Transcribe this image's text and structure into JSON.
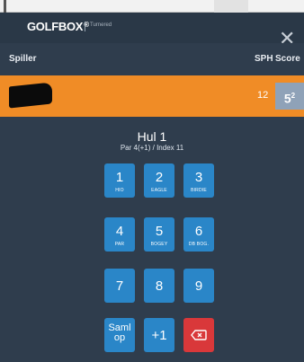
{
  "header": {
    "logo": "GOLFBOX",
    "logo_reg": "®",
    "logo_sub": "Turnered",
    "close_label": "✕"
  },
  "columns": {
    "player": "Spiller",
    "sph": "SPH",
    "score": "Score"
  },
  "player_row": {
    "sph": "12",
    "score": "5",
    "score_sup": "2"
  },
  "hole": {
    "title": "Hul 1",
    "subtitle": "Par 4(+1) / Index 11"
  },
  "keypad": {
    "k1": {
      "num": "1",
      "label": "HIO"
    },
    "k2": {
      "num": "2",
      "label": "EAGLE"
    },
    "k3": {
      "num": "3",
      "label": "BIRDIE"
    },
    "k4": {
      "num": "4",
      "label": "PAR"
    },
    "k5": {
      "num": "5",
      "label": "BOGEY"
    },
    "k6": {
      "num": "6",
      "label": "DB BOG."
    },
    "k7": {
      "num": "7"
    },
    "k8": {
      "num": "8"
    },
    "k9": {
      "num": "9"
    },
    "saml_line1": "Saml",
    "saml_line2": "op",
    "plus1": "+1"
  },
  "colors": {
    "background": "#2f3d4d",
    "header": "#2a3847",
    "accent_orange": "#f08c26",
    "key_blue": "#2a86c8",
    "delete_red": "#d9383a",
    "score_box": "#8fa2b8"
  }
}
